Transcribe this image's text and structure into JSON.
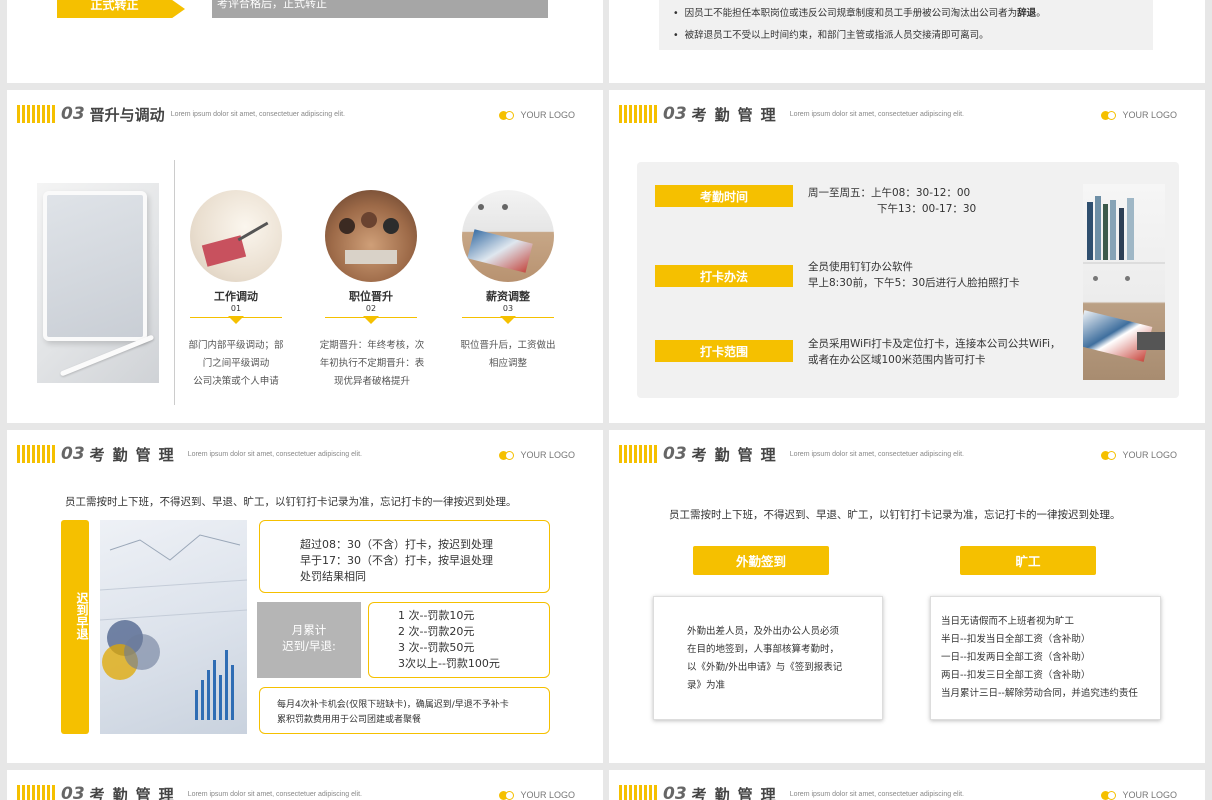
{
  "logo": "YOUR LOGO",
  "lorem": "Lorem ipsum dolor sit amet, consectetuer adipiscing elit.",
  "section_num": "03",
  "colors": {
    "accent": "#f5c000",
    "gray_bar": "#a6a6a6",
    "panel_bg": "#f1f1f1"
  },
  "slide_top_left": {
    "tag": "正式转正",
    "bar_text": "考评合格后，正式转正"
  },
  "slide_top_right": {
    "bullets": [
      {
        "pre": "因员工不能担任本职岗位或违反公司规章制度和员工手册被公司淘汰出公司者为",
        "bold": "辞退",
        "post": "。"
      },
      {
        "pre": "被辞退员工不受以上时间约束，和部门主管或指派人员交接清即可离司。",
        "bold": "",
        "post": ""
      }
    ]
  },
  "promotion": {
    "title": "晋升与调动",
    "items": [
      {
        "title": "工作调动",
        "num": "01",
        "lines": [
          "部门内部平级调动；部",
          "门之间平级调动",
          "公司决策或个人申请"
        ]
      },
      {
        "title": "职位晋升",
        "num": "02",
        "lines": [
          "定期晋升：年终考核，次",
          "年初执行不定期晋升：表",
          "现优异者破格提升"
        ]
      },
      {
        "title": "薪资调整",
        "num": "03",
        "lines": [
          "职位晋升后，工资做出",
          "相应调整"
        ]
      }
    ]
  },
  "attendance_title": "考勤管理",
  "attendance_mgmt": {
    "rows": [
      {
        "label": "考勤时间",
        "lines": [
          "周一至周五：上午08：30-12：00",
          "下午13：00-17：30"
        ]
      },
      {
        "label": "打卡办法",
        "lines": [
          "全员使用钉钉办公软件",
          "早上8:30前，下午5：30后进行人脸拍照打卡"
        ]
      },
      {
        "label": "打卡范围",
        "lines": [
          "全员采用WiFi打卡及定位打卡，连接本公司公共WiFi，",
          "或者在办公区域100米范围内皆可打卡"
        ]
      }
    ]
  },
  "late_slide": {
    "intro": "员工需按时上下班，不得迟到、早退、旷工，以钉钉打卡记录为准，忘记打卡的一律按迟到处理。",
    "side_label": "迟到早退",
    "box1": [
      "超过08：30（不含）打卡，按迟到处理",
      "早于17：30（不含）打卡，按早退处理",
      "处罚结果相同"
    ],
    "gray_label": [
      "月累计",
      "迟到/早退:"
    ],
    "box2": [
      "1 次--罚款10元",
      "2 次--罚款20元",
      "3 次--罚款50元",
      "3次以上--罚款100元"
    ],
    "box3": [
      "每月4次补卡机会(仅限下班缺卡)，确属迟到/早退不予补卡",
      "累积罚款费用用于公司团建或者聚餐"
    ]
  },
  "absence_slide": {
    "intro": "员工需按时上下班，不得迟到、早退、旷工，以钉钉打卡记录为准，忘记打卡的一律按迟到处理。",
    "left_label": "外勤签到",
    "right_label": "旷工",
    "left_lines": [
      "外勤出差人员，及外出办公人员必须",
      "在目的地签到，人事部核算考勤时，",
      "以《外勤/外出申请》与《签到报表记",
      "录》为准"
    ],
    "right_lines": [
      "当日无请假而不上班者视为旷工",
      "半日--扣发当日全部工资（含补助）",
      "一日--扣发两日全部工资（含补助）",
      "两日--扣发三日全部工资（含补助）",
      "当月累计三日--解除劳动合同，并追究违约责任"
    ]
  }
}
